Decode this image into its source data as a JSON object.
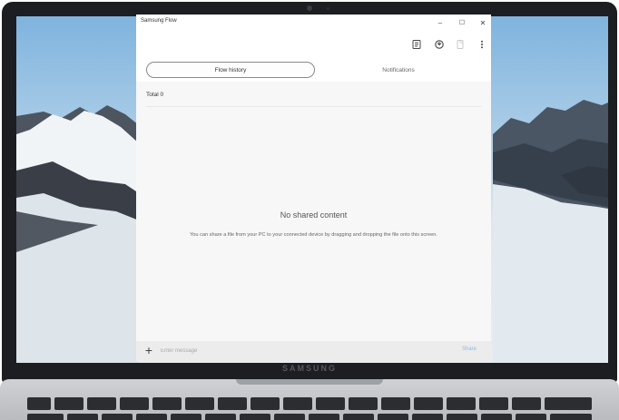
{
  "device": {
    "brand_text": "SAMSUNG"
  },
  "window": {
    "title": "Samsung Flow",
    "controls": {
      "minimize": "–",
      "maximize": "☐",
      "close": "✕"
    }
  },
  "toolbar": {
    "icons": [
      "notes-icon",
      "sync-icon",
      "device-icon",
      "more-menu-icon"
    ]
  },
  "tabs": [
    {
      "label": "Flow history",
      "active": true
    },
    {
      "label": "Notifications",
      "active": false
    }
  ],
  "content": {
    "total_label": "Total 0",
    "empty_title": "No shared content",
    "empty_desc": "You can share a file from your PC to your connected device by dragging and dropping the file onto this screen."
  },
  "input_bar": {
    "add_symbol": "+",
    "placeholder": "Enter message",
    "share_label": "Share"
  },
  "colors": {
    "accent": "#8fb8e0",
    "app_bg": "#f7f7f7",
    "bezel": "#1d1e21"
  }
}
